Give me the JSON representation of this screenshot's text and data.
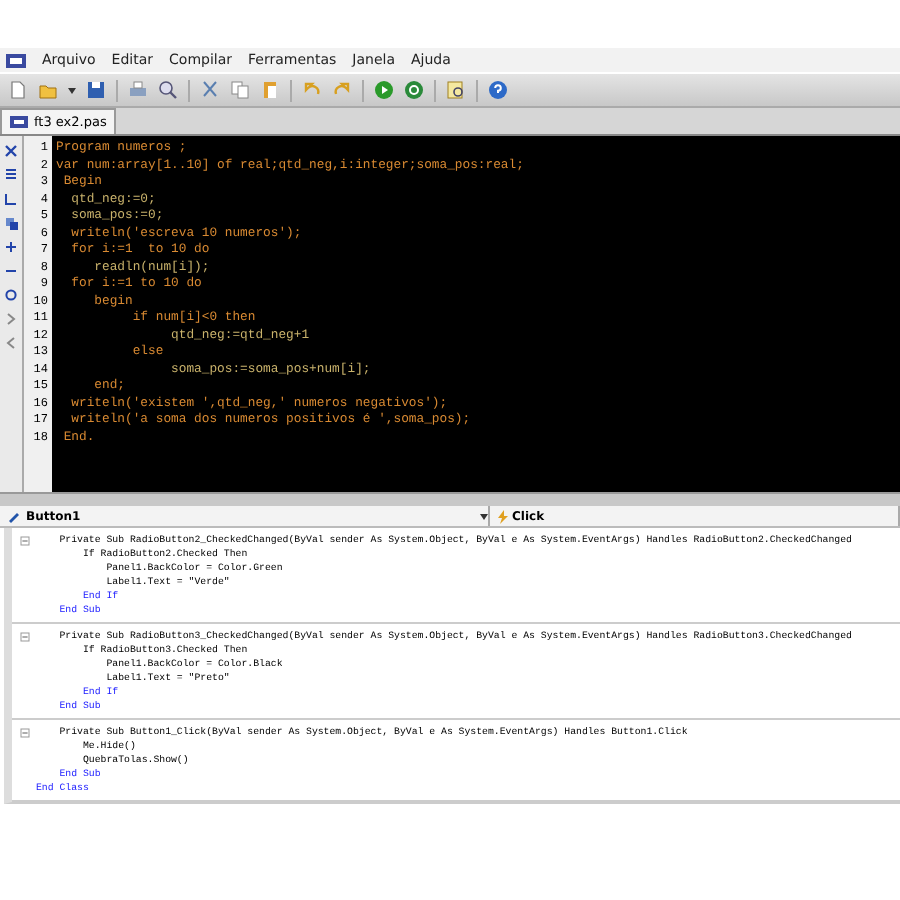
{
  "menu": [
    "Arquivo",
    "Editar",
    "Compilar",
    "Ferramentas",
    "Janela",
    "Ajuda"
  ],
  "tabs": [
    {
      "label": "ft3 ex2.pas",
      "selected": true
    }
  ],
  "pascal": [
    {
      "text": "Program numeros ;",
      "kind": "keyword"
    },
    {
      "text": "var num:array[1..10] of real;qtd_neg,i:integer;soma_pos:real;",
      "kind": "keyword"
    },
    {
      "text": " Begin",
      "kind": "keyword"
    },
    {
      "text": "  qtd_neg:=0;",
      "kind": "plain"
    },
    {
      "text": "  soma_pos:=0;",
      "kind": "plain"
    },
    {
      "text": "  writeln('escreva 10 numeros');",
      "kind": "keyword"
    },
    {
      "text": "  for i:=1  to 10 do",
      "kind": "keyword"
    },
    {
      "text": "     readln(num[i]);",
      "kind": "plain"
    },
    {
      "text": "  for i:=1 to 10 do",
      "kind": "keyword"
    },
    {
      "text": "     begin",
      "kind": "keyword"
    },
    {
      "text": "          if num[i]<0 then",
      "kind": "keyword"
    },
    {
      "text": "               qtd_neg:=qtd_neg+1",
      "kind": "plain"
    },
    {
      "text": "          else",
      "kind": "keyword"
    },
    {
      "text": "               soma_pos:=soma_pos+num[i];",
      "kind": "plain"
    },
    {
      "text": "     end;",
      "kind": "keyword"
    },
    {
      "text": "  writeln('existem ',qtd_neg,' numeros negativos');",
      "kind": "keyword"
    },
    {
      "text": "  writeln('a soma dos numeros positivos é ',soma_pos);",
      "kind": "keyword"
    },
    {
      "text": " End.",
      "kind": "keyword"
    }
  ],
  "line_numbers": [
    "1",
    "2",
    "3",
    "4",
    "5",
    "6",
    "7",
    "8",
    "9",
    "10",
    "11",
    "12",
    "13",
    "14",
    "15",
    "16",
    "17",
    "18"
  ],
  "vb_bar": {
    "object": "Button1",
    "event": "Click"
  },
  "vb_blocks": [
    [
      {
        "text": "    Private Sub RadioButton2_CheckedChanged(ByVal sender As System.Object, ByVal e As System.EventArgs) Handles RadioButton2.CheckedChanged",
        "kind": "plain"
      },
      {
        "text": "        If RadioButton2.Checked Then",
        "kind": "plain"
      },
      {
        "text": "            Panel1.BackColor = Color.Green",
        "kind": "plain"
      },
      {
        "text": "            Label1.Text = \"Verde\"",
        "kind": "plain"
      },
      {
        "text": "        End If",
        "kind": "keyword"
      },
      {
        "text": "    End Sub",
        "kind": "keyword"
      }
    ],
    [
      {
        "text": "    Private Sub RadioButton3_CheckedChanged(ByVal sender As System.Object, ByVal e As System.EventArgs) Handles RadioButton3.CheckedChanged",
        "kind": "plain"
      },
      {
        "text": "        If RadioButton3.Checked Then",
        "kind": "plain"
      },
      {
        "text": "            Panel1.BackColor = Color.Black",
        "kind": "plain"
      },
      {
        "text": "            Label1.Text = \"Preto\"",
        "kind": "plain"
      },
      {
        "text": "        End If",
        "kind": "keyword"
      },
      {
        "text": "    End Sub",
        "kind": "keyword"
      }
    ],
    [
      {
        "text": "    Private Sub Button1_Click(ByVal sender As System.Object, ByVal e As System.EventArgs) Handles Button1.Click",
        "kind": "plain"
      },
      {
        "text": "        Me.Hide()",
        "kind": "plain"
      },
      {
        "text": "        QuebraTolas.Show()",
        "kind": "plain"
      },
      {
        "text": "    End Sub",
        "kind": "keyword"
      },
      {
        "text": "End Class",
        "kind": "keyword"
      }
    ]
  ]
}
